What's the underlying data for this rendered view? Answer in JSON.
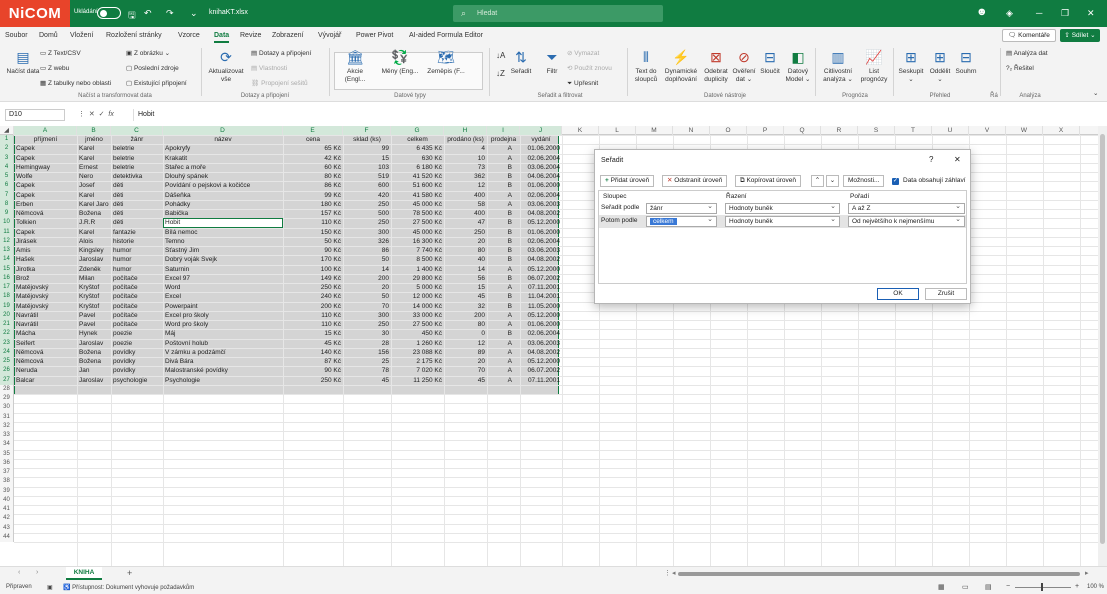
{
  "titlebar": {
    "logo": "NiCOM",
    "autosave_label": "Ukládání",
    "filename": "knihaKT.xlsx",
    "search_placeholder": "Hledat"
  },
  "menu": {
    "items": [
      "Soubor",
      "Domů",
      "Vložení",
      "Rozložení stránky",
      "Vzorce",
      "Data",
      "Revize",
      "Zobrazení",
      "Vývojář",
      "Power Pivot",
      "AI-aided Formula Editor"
    ],
    "active": "Data",
    "comments": "Komentáře",
    "share": "Sdílet"
  },
  "ribbon": {
    "get_data": {
      "big": "Načíst data",
      "items": [
        "Z Text/CSV",
        "Z webu",
        "Z tabulky nebo oblasti",
        "Z obrázku",
        "Poslední zdroje",
        "Existující připojení"
      ],
      "group": "Načíst a transformovat data"
    },
    "queries": {
      "big": "Aktualizovat vše",
      "items": [
        "Dotazy a připojení",
        "Vlastnosti",
        "Propojení sešitů"
      ],
      "group": "Dotazy a připojení"
    },
    "types": {
      "items": [
        "Akcie (Engl...",
        "Měny (Eng...",
        "Zeměpis (F..."
      ],
      "group": "Datové typy"
    },
    "sort": {
      "sort": "Seřadit",
      "filter": "Filtr",
      "items": [
        "Vymazat",
        "Použít znovu",
        "Upřesnit"
      ],
      "group": "Seřadit a filtrovat"
    },
    "tools": {
      "items": [
        "Text do sloupců",
        "Dynamické doplňování",
        "Odebrat duplicity",
        "Ověření dat",
        "Sloučit",
        "Datový Model"
      ],
      "group": "Datové nástroje"
    },
    "forecast": {
      "items": [
        "Citlivostní analýza",
        "List prognózy"
      ],
      "group": "Prognóza"
    },
    "outline": {
      "items": [
        "Seskupit",
        "Oddělit",
        "Souhrn"
      ],
      "group": "Přehled",
      "extra": "Řá"
    },
    "analysis": {
      "items": [
        "Analýza dat",
        "Řešitel"
      ],
      "group": "Analýza"
    }
  },
  "formula_bar": {
    "namebox": "D10",
    "value": "Hobit"
  },
  "columns": [
    "A",
    "B",
    "C",
    "D",
    "E",
    "F",
    "G",
    "H",
    "I",
    "J",
    "K",
    "L",
    "M",
    "N",
    "O",
    "P",
    "Q",
    "R",
    "S",
    "T",
    "U",
    "V",
    "W",
    "X"
  ],
  "headers": [
    "příjmení",
    "jméno",
    "žánr",
    "název",
    "cena",
    "sklad (ks)",
    "celkem",
    "prodáno (ks)",
    "prodejna",
    "vydání"
  ],
  "rows": [
    [
      "Čapek",
      "Karel",
      "beletrie",
      "Apokryfy",
      "65 Kč",
      "99",
      "6 435 Kč",
      "4",
      "A",
      "01.06.2000"
    ],
    [
      "Čapek",
      "Karel",
      "beletrie",
      "Krakatit",
      "42 Kč",
      "15",
      "630 Kč",
      "10",
      "A",
      "02.06.2004"
    ],
    [
      "Hemingway",
      "Ernest",
      "beletrie",
      "Stařec a moře",
      "60 Kč",
      "103",
      "6 180 Kč",
      "73",
      "B",
      "03.06.2004"
    ],
    [
      "Wolfe",
      "Nero",
      "detektivka",
      "Dlouhý spánek",
      "80 Kč",
      "519",
      "41 520 Kč",
      "362",
      "B",
      "04.06.2004"
    ],
    [
      "Čapek",
      "Josef",
      "děti",
      "Povídání o pejskovi a kočičce",
      "86 Kč",
      "600",
      "51 600 Kč",
      "12",
      "B",
      "01.06.2000"
    ],
    [
      "Čapek",
      "Karel",
      "děti",
      "Dášeňka",
      "99 Kč",
      "420",
      "41 580 Kč",
      "400",
      "A",
      "02.06.2004"
    ],
    [
      "Erben",
      "Karel Jaromír",
      "děti",
      "Pohádky",
      "180 Kč",
      "250",
      "45 000 Kč",
      "58",
      "A",
      "03.06.2003"
    ],
    [
      "Němcová",
      "Božena",
      "děti",
      "Babička",
      "157 Kč",
      "500",
      "78 500 Kč",
      "400",
      "B",
      "04.08.2002"
    ],
    [
      "Tolkien",
      "J.R.R",
      "děti",
      "Hobit",
      "110 Kč",
      "250",
      "27 500 Kč",
      "47",
      "B",
      "05.12.2000"
    ],
    [
      "Čapek",
      "Karel",
      "fantazie",
      "Bílá nemoc",
      "150 Kč",
      "300",
      "45 000 Kč",
      "250",
      "B",
      "01.06.2000"
    ],
    [
      "Jirásek",
      "Alois",
      "historie",
      "Temno",
      "50 Kč",
      "326",
      "16 300 Kč",
      "20",
      "B",
      "02.06.2004"
    ],
    [
      "Amis",
      "Kingsley",
      "humor",
      "Šťastný Jim",
      "90 Kč",
      "86",
      "7 740 Kč",
      "80",
      "B",
      "03.06.2003"
    ],
    [
      "Hašek",
      "Jaroslav",
      "humor",
      "Dobrý voják Švejk",
      "170 Kč",
      "50",
      "8 500 Kč",
      "40",
      "B",
      "04.08.2002"
    ],
    [
      "Jirotka",
      "Zdeněk",
      "humor",
      "Saturnin",
      "100 Kč",
      "14",
      "1 400 Kč",
      "14",
      "A",
      "05.12.2000"
    ],
    [
      "Brož",
      "Milan",
      "počítače",
      "Excel 97",
      "149 Kč",
      "200",
      "29 800 Kč",
      "56",
      "B",
      "06.07.2002"
    ],
    [
      "Matějovský",
      "Kryštof",
      "počítače",
      "Word",
      "250 Kč",
      "20",
      "5 000 Kč",
      "15",
      "A",
      "07.11.2001"
    ],
    [
      "Matějovský",
      "Kryštof",
      "počítače",
      "Excel",
      "240 Kč",
      "50",
      "12 000 Kč",
      "45",
      "B",
      "11.04.2001"
    ],
    [
      "Matějovský",
      "Kryštof",
      "počítače",
      "Powerpaint",
      "200 Kč",
      "70",
      "14 000 Kč",
      "32",
      "B",
      "11.05.2000"
    ],
    [
      "Navrátil",
      "Pavel",
      "počítače",
      "Excel pro školy",
      "110 Kč",
      "300",
      "33 000 Kč",
      "200",
      "A",
      "05.12.2000"
    ],
    [
      "Navrátil",
      "Pavel",
      "počítače",
      "Word pro školy",
      "110 Kč",
      "250",
      "27 500 Kč",
      "80",
      "A",
      "01.06.2000"
    ],
    [
      "Mácha",
      "Hynek",
      "poezie",
      "Máj",
      "15 Kč",
      "30",
      "450 Kč",
      "0",
      "B",
      "02.06.2004"
    ],
    [
      "Seifert",
      "Jaroslav",
      "poezie",
      "Poštovní holub",
      "45 Kč",
      "28",
      "1 260 Kč",
      "12",
      "A",
      "03.06.2003"
    ],
    [
      "Němcová",
      "Božena",
      "povídky",
      "V zámku a podzámčí",
      "140 Kč",
      "156",
      "23 088 Kč",
      "89",
      "A",
      "04.08.2002"
    ],
    [
      "Němcová",
      "Božena",
      "povídky",
      "Divá Bára",
      "87 Kč",
      "25",
      "2 175 Kč",
      "20",
      "A",
      "05.12.2000"
    ],
    [
      "Neruda",
      "Jan",
      "povídky",
      "Malostranské povídky",
      "90 Kč",
      "78",
      "7 020 Kč",
      "70",
      "A",
      "06.07.2002"
    ],
    [
      "Balcar",
      "Jaroslav",
      "psychologie",
      "Psychologie",
      "250 Kč",
      "45",
      "11 250 Kč",
      "45",
      "A",
      "07.11.2001"
    ]
  ],
  "row_numbers": [
    "1",
    "2",
    "3",
    "4",
    "5",
    "6",
    "7",
    "8",
    "9",
    "10",
    "11",
    "12",
    "13",
    "14",
    "15",
    "16",
    "17",
    "18",
    "19",
    "20",
    "21",
    "22",
    "23",
    "24",
    "25",
    "26",
    "27",
    "28",
    "29",
    "30",
    "31",
    "32",
    "33",
    "34",
    "35",
    "36",
    "37",
    "38",
    "39",
    "40",
    "41",
    "42",
    "43",
    "44"
  ],
  "dialog": {
    "title": "Seřadit",
    "help": "?",
    "close": "✕",
    "add_level": "Přidat úroveň",
    "delete_level": "Odstranit úroveň",
    "copy_level": "Kopírovat úroveň",
    "options": "Možnosti...",
    "has_headers": "Data obsahují záhlaví",
    "col_header": "Sloupec",
    "sort_on_header": "Řazení",
    "order_header": "Pořadí",
    "levels": [
      {
        "label": "Seřadit podle",
        "column": "žánr",
        "sort_on": "Hodnoty buněk",
        "order": "A až Z"
      },
      {
        "label": "Potom podle",
        "column": "celkem",
        "sort_on": "Hodnoty buněk",
        "order": "Od největšího k nejmenšímu"
      }
    ],
    "ok": "OK",
    "cancel": "Zrušit"
  },
  "sheet": {
    "tab": "KNIHA",
    "add": "+"
  },
  "status": {
    "ready": "Připraven",
    "accessibility": "Přístupnost: Dokument vyhovuje požadavkům",
    "zoom": "100 %"
  }
}
